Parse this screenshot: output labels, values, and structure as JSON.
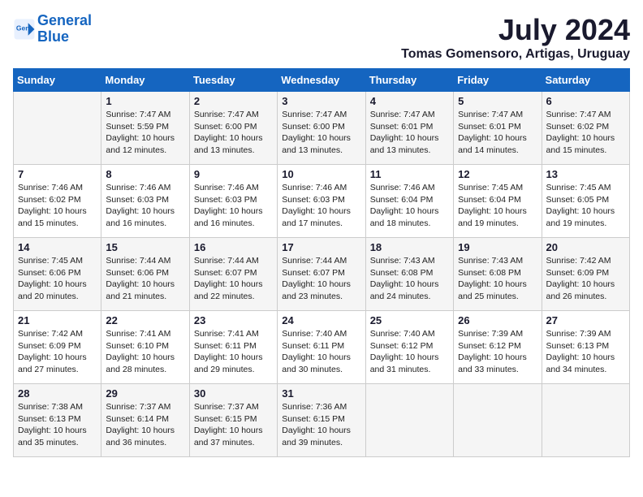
{
  "logo": {
    "line1": "General",
    "line2": "Blue"
  },
  "title": "July 2024",
  "location": "Tomas Gomensoro, Artigas, Uruguay",
  "days_of_week": [
    "Sunday",
    "Monday",
    "Tuesday",
    "Wednesday",
    "Thursday",
    "Friday",
    "Saturday"
  ],
  "weeks": [
    [
      {
        "day": "",
        "sunrise": "",
        "sunset": "",
        "daylight": ""
      },
      {
        "day": "1",
        "sunrise": "Sunrise: 7:47 AM",
        "sunset": "Sunset: 5:59 PM",
        "daylight": "Daylight: 10 hours and 12 minutes."
      },
      {
        "day": "2",
        "sunrise": "Sunrise: 7:47 AM",
        "sunset": "Sunset: 6:00 PM",
        "daylight": "Daylight: 10 hours and 13 minutes."
      },
      {
        "day": "3",
        "sunrise": "Sunrise: 7:47 AM",
        "sunset": "Sunset: 6:00 PM",
        "daylight": "Daylight: 10 hours and 13 minutes."
      },
      {
        "day": "4",
        "sunrise": "Sunrise: 7:47 AM",
        "sunset": "Sunset: 6:01 PM",
        "daylight": "Daylight: 10 hours and 13 minutes."
      },
      {
        "day": "5",
        "sunrise": "Sunrise: 7:47 AM",
        "sunset": "Sunset: 6:01 PM",
        "daylight": "Daylight: 10 hours and 14 minutes."
      },
      {
        "day": "6",
        "sunrise": "Sunrise: 7:47 AM",
        "sunset": "Sunset: 6:02 PM",
        "daylight": "Daylight: 10 hours and 15 minutes."
      }
    ],
    [
      {
        "day": "7",
        "sunrise": "Sunrise: 7:46 AM",
        "sunset": "Sunset: 6:02 PM",
        "daylight": "Daylight: 10 hours and 15 minutes."
      },
      {
        "day": "8",
        "sunrise": "Sunrise: 7:46 AM",
        "sunset": "Sunset: 6:03 PM",
        "daylight": "Daylight: 10 hours and 16 minutes."
      },
      {
        "day": "9",
        "sunrise": "Sunrise: 7:46 AM",
        "sunset": "Sunset: 6:03 PM",
        "daylight": "Daylight: 10 hours and 16 minutes."
      },
      {
        "day": "10",
        "sunrise": "Sunrise: 7:46 AM",
        "sunset": "Sunset: 6:03 PM",
        "daylight": "Daylight: 10 hours and 17 minutes."
      },
      {
        "day": "11",
        "sunrise": "Sunrise: 7:46 AM",
        "sunset": "Sunset: 6:04 PM",
        "daylight": "Daylight: 10 hours and 18 minutes."
      },
      {
        "day": "12",
        "sunrise": "Sunrise: 7:45 AM",
        "sunset": "Sunset: 6:04 PM",
        "daylight": "Daylight: 10 hours and 19 minutes."
      },
      {
        "day": "13",
        "sunrise": "Sunrise: 7:45 AM",
        "sunset": "Sunset: 6:05 PM",
        "daylight": "Daylight: 10 hours and 19 minutes."
      }
    ],
    [
      {
        "day": "14",
        "sunrise": "Sunrise: 7:45 AM",
        "sunset": "Sunset: 6:06 PM",
        "daylight": "Daylight: 10 hours and 20 minutes."
      },
      {
        "day": "15",
        "sunrise": "Sunrise: 7:44 AM",
        "sunset": "Sunset: 6:06 PM",
        "daylight": "Daylight: 10 hours and 21 minutes."
      },
      {
        "day": "16",
        "sunrise": "Sunrise: 7:44 AM",
        "sunset": "Sunset: 6:07 PM",
        "daylight": "Daylight: 10 hours and 22 minutes."
      },
      {
        "day": "17",
        "sunrise": "Sunrise: 7:44 AM",
        "sunset": "Sunset: 6:07 PM",
        "daylight": "Daylight: 10 hours and 23 minutes."
      },
      {
        "day": "18",
        "sunrise": "Sunrise: 7:43 AM",
        "sunset": "Sunset: 6:08 PM",
        "daylight": "Daylight: 10 hours and 24 minutes."
      },
      {
        "day": "19",
        "sunrise": "Sunrise: 7:43 AM",
        "sunset": "Sunset: 6:08 PM",
        "daylight": "Daylight: 10 hours and 25 minutes."
      },
      {
        "day": "20",
        "sunrise": "Sunrise: 7:42 AM",
        "sunset": "Sunset: 6:09 PM",
        "daylight": "Daylight: 10 hours and 26 minutes."
      }
    ],
    [
      {
        "day": "21",
        "sunrise": "Sunrise: 7:42 AM",
        "sunset": "Sunset: 6:09 PM",
        "daylight": "Daylight: 10 hours and 27 minutes."
      },
      {
        "day": "22",
        "sunrise": "Sunrise: 7:41 AM",
        "sunset": "Sunset: 6:10 PM",
        "daylight": "Daylight: 10 hours and 28 minutes."
      },
      {
        "day": "23",
        "sunrise": "Sunrise: 7:41 AM",
        "sunset": "Sunset: 6:11 PM",
        "daylight": "Daylight: 10 hours and 29 minutes."
      },
      {
        "day": "24",
        "sunrise": "Sunrise: 7:40 AM",
        "sunset": "Sunset: 6:11 PM",
        "daylight": "Daylight: 10 hours and 30 minutes."
      },
      {
        "day": "25",
        "sunrise": "Sunrise: 7:40 AM",
        "sunset": "Sunset: 6:12 PM",
        "daylight": "Daylight: 10 hours and 31 minutes."
      },
      {
        "day": "26",
        "sunrise": "Sunrise: 7:39 AM",
        "sunset": "Sunset: 6:12 PM",
        "daylight": "Daylight: 10 hours and 33 minutes."
      },
      {
        "day": "27",
        "sunrise": "Sunrise: 7:39 AM",
        "sunset": "Sunset: 6:13 PM",
        "daylight": "Daylight: 10 hours and 34 minutes."
      }
    ],
    [
      {
        "day": "28",
        "sunrise": "Sunrise: 7:38 AM",
        "sunset": "Sunset: 6:13 PM",
        "daylight": "Daylight: 10 hours and 35 minutes."
      },
      {
        "day": "29",
        "sunrise": "Sunrise: 7:37 AM",
        "sunset": "Sunset: 6:14 PM",
        "daylight": "Daylight: 10 hours and 36 minutes."
      },
      {
        "day": "30",
        "sunrise": "Sunrise: 7:37 AM",
        "sunset": "Sunset: 6:15 PM",
        "daylight": "Daylight: 10 hours and 37 minutes."
      },
      {
        "day": "31",
        "sunrise": "Sunrise: 7:36 AM",
        "sunset": "Sunset: 6:15 PM",
        "daylight": "Daylight: 10 hours and 39 minutes."
      },
      {
        "day": "",
        "sunrise": "",
        "sunset": "",
        "daylight": ""
      },
      {
        "day": "",
        "sunrise": "",
        "sunset": "",
        "daylight": ""
      },
      {
        "day": "",
        "sunrise": "",
        "sunset": "",
        "daylight": ""
      }
    ]
  ]
}
